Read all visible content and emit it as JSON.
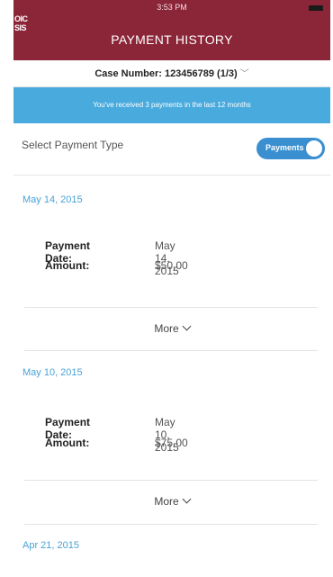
{
  "status_bar": {
    "time": "3:53 PM",
    "signal": ""
  },
  "header": {
    "logo_text": "OIC\nSIS",
    "title": "PAYMENT HISTORY"
  },
  "case": {
    "label": "Case Number: 123456789 (1/3)"
  },
  "banner": {
    "text": "You've received 3 payments in the last 12 months"
  },
  "payment_type": {
    "label": "Select Payment Type",
    "toggle_label": "Payments"
  },
  "detail_labels": {
    "date": "Payment Date:",
    "amount": "Amount:"
  },
  "more_label": "More",
  "payments": [
    {
      "header": "May 14, 2015",
      "date": "May 14, 2015",
      "amount": "$50.00"
    },
    {
      "header": "May 10, 2015",
      "date": "May 10, 2015",
      "amount": "$75.00"
    },
    {
      "header": "Apr 21, 2015"
    }
  ],
  "colors": {
    "header_bg": "#8b2538",
    "banner_bg": "#49aadd",
    "toggle_bg": "#3a8fd0",
    "link": "#48a2d6"
  }
}
